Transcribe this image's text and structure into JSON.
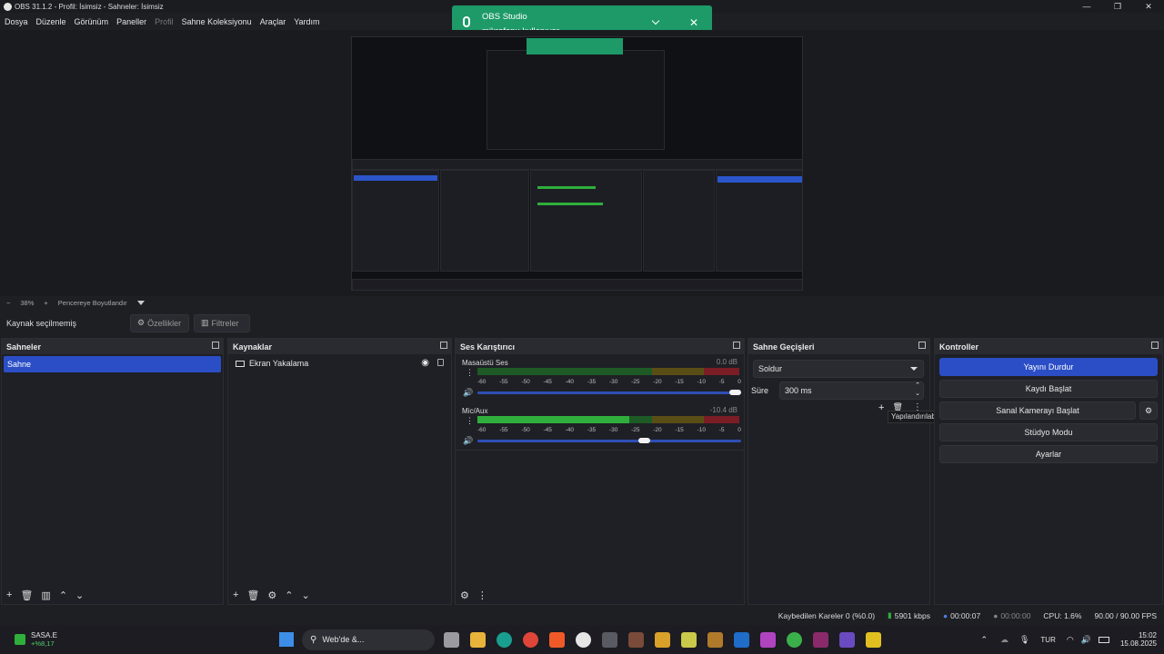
{
  "window": {
    "title": "OBS 31.1.2 - Profil: İsimsiz - Sahneler: İsimsiz",
    "controls": [
      "—",
      "❐",
      "✕"
    ]
  },
  "menu": [
    "Dosya",
    "Düzenle",
    "Görünüm",
    "Paneller",
    "Profil",
    "Sahne Koleksiyonu",
    "Araçlar",
    "Yardım"
  ],
  "menu_disabled_index": 4,
  "notification": {
    "title": "OBS Studio",
    "body": "mikrofonu kullanıyor",
    "icons": [
      "mic-icon",
      "chevron-down-icon",
      "close-icon"
    ]
  },
  "zoombar": {
    "minus": "−",
    "zoom": "38%",
    "plus": "+",
    "mode": "Pencereye Boyutlandır"
  },
  "source_toolbar": {
    "label": "Kaynak seçilmemiş",
    "properties": "Özellikler",
    "filters": "Filtreler"
  },
  "scenes": {
    "title": "Sahneler",
    "items": [
      "Sahne"
    ]
  },
  "sources": {
    "title": "Kaynaklar",
    "items": [
      {
        "name": "Ekran Yakalama",
        "visible": true,
        "locked": false
      }
    ]
  },
  "mixer": {
    "title": "Ses Karıştırıcı",
    "ticks": [
      "-60",
      "-55",
      "-50",
      "-45",
      "-40",
      "-35",
      "-30",
      "-25",
      "-20",
      "-15",
      "-10",
      "-5",
      "0"
    ],
    "channels": [
      {
        "name": "Masaüstü Ses",
        "db": "0.0 dB",
        "level": 0,
        "volume": 1.0
      },
      {
        "name": "Mic/Aux",
        "db": "-10.4 dB",
        "level": 0.58,
        "volume": 0.64
      }
    ]
  },
  "transitions": {
    "title": "Sahne Geçişleri",
    "selected": "Soldur",
    "duration_label": "Süre",
    "duration_value": "300 ms",
    "tooltip": "Yapılandırılabilir Geçiş Ekle"
  },
  "controls": {
    "title": "Kontroller",
    "buttons": [
      "Yayını Durdur",
      "Kaydı Başlat",
      "Sanal Kamerayı Başlat",
      "Stüdyo Modu",
      "Ayarlar"
    ]
  },
  "status": {
    "dropped": "Kaybedilen Kareler 0 (%0.0)",
    "bitrate": "5901 kbps",
    "stream_time": "00:00:07",
    "rec_time": "00:00:00",
    "cpu": "CPU: 1.6%",
    "fps": "90.00 / 90.00 FPS"
  },
  "taskbar": {
    "stock_name": "SASA.E",
    "stock_change": "+%8,17",
    "search": "Web'de &...",
    "lang": "TUR",
    "time": "15:02",
    "date": "15.08.2025"
  },
  "colors": {
    "accent": "#2b4ec7",
    "notification": "#1d9a68",
    "meter_green": "#2fae3c",
    "meter_yellow": "#8a7a1c",
    "meter_red": "#7a1d24"
  }
}
